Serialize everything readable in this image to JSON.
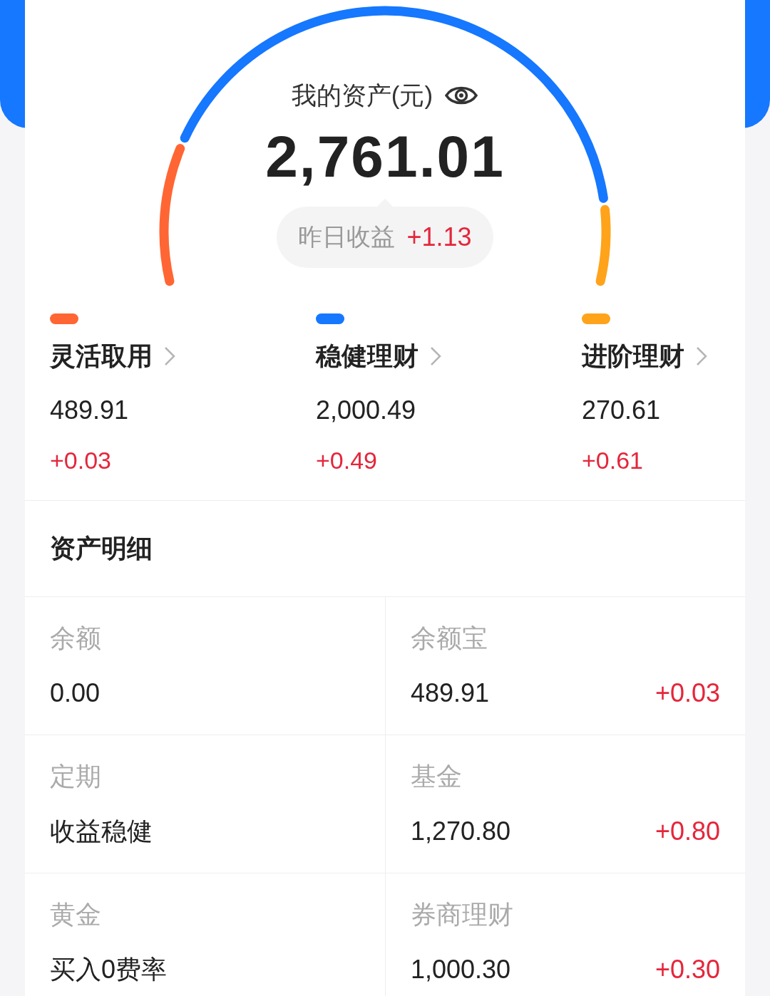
{
  "summary": {
    "title": "我的资产(元)",
    "total": "2,761.01",
    "yesterday_label": "昨日收益",
    "yesterday_value": "+1.13"
  },
  "categories": [
    {
      "name": "灵活取用",
      "value": "489.91",
      "change": "+0.03",
      "color": "#ff6633"
    },
    {
      "name": "稳健理财",
      "value": "2,000.49",
      "change": "+0.49",
      "color": "#1677ff"
    },
    {
      "name": "进阶理财",
      "value": "270.61",
      "change": "+0.61",
      "color": "#ffa31a"
    }
  ],
  "details": {
    "title": "资产明细",
    "items": [
      {
        "label": "余额",
        "value": "0.00"
      },
      {
        "label": "余额宝",
        "value": "489.91",
        "change": "+0.03"
      },
      {
        "label": "定期",
        "value": "收益稳健"
      },
      {
        "label": "基金",
        "value": "1,270.80",
        "change": "+0.80"
      },
      {
        "label": "黄金",
        "value": "买入0费率"
      },
      {
        "label": "券商理财",
        "value": "1,000.30",
        "change": "+0.30"
      }
    ]
  }
}
